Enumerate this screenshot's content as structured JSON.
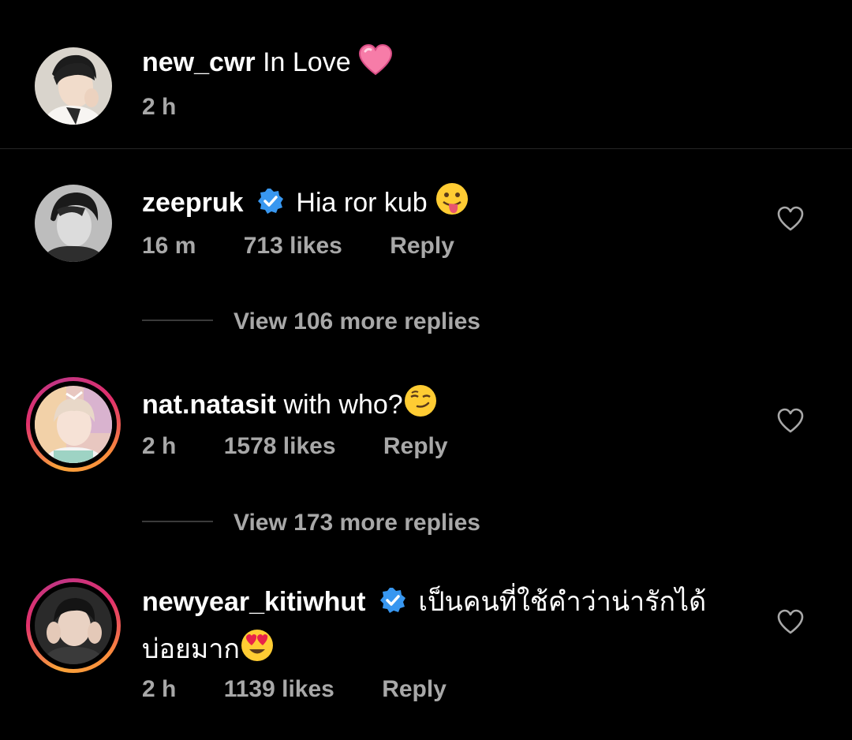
{
  "caption": {
    "username": "new_cwr",
    "text": "In Love",
    "emoji": "pink-heart-icon",
    "time": "2 h"
  },
  "comments": [
    {
      "username": "zeepruk",
      "verified": true,
      "text": "Hia ror kub",
      "emoji": "tongue-out-face-icon",
      "time": "16 m",
      "likes": "713 likes",
      "reply": "Reply",
      "view_replies": "View 106 more replies"
    },
    {
      "username": "nat.natasit",
      "verified": false,
      "text": "with who?",
      "emoji": "smirk-face-icon",
      "time": "2 h",
      "likes": "1578 likes",
      "reply": "Reply",
      "view_replies": "View 173 more replies"
    },
    {
      "username": "newyear_kitiwhut",
      "verified": true,
      "text": "เป็นคนที่ใช้คำว่าน่ารักได้",
      "text_line2": "บ่อยมาก",
      "emoji": "heart-eyes-face-icon",
      "time": "2 h",
      "likes": "1139 likes",
      "reply": "Reply"
    }
  ],
  "colors": {
    "background": "#000000",
    "primary_text": "#ffffff",
    "secondary_text": "#a8a8a8",
    "verified_blue": "#3897f0",
    "story_ring_start": "#f9a33a",
    "story_ring_end": "#c13584"
  }
}
